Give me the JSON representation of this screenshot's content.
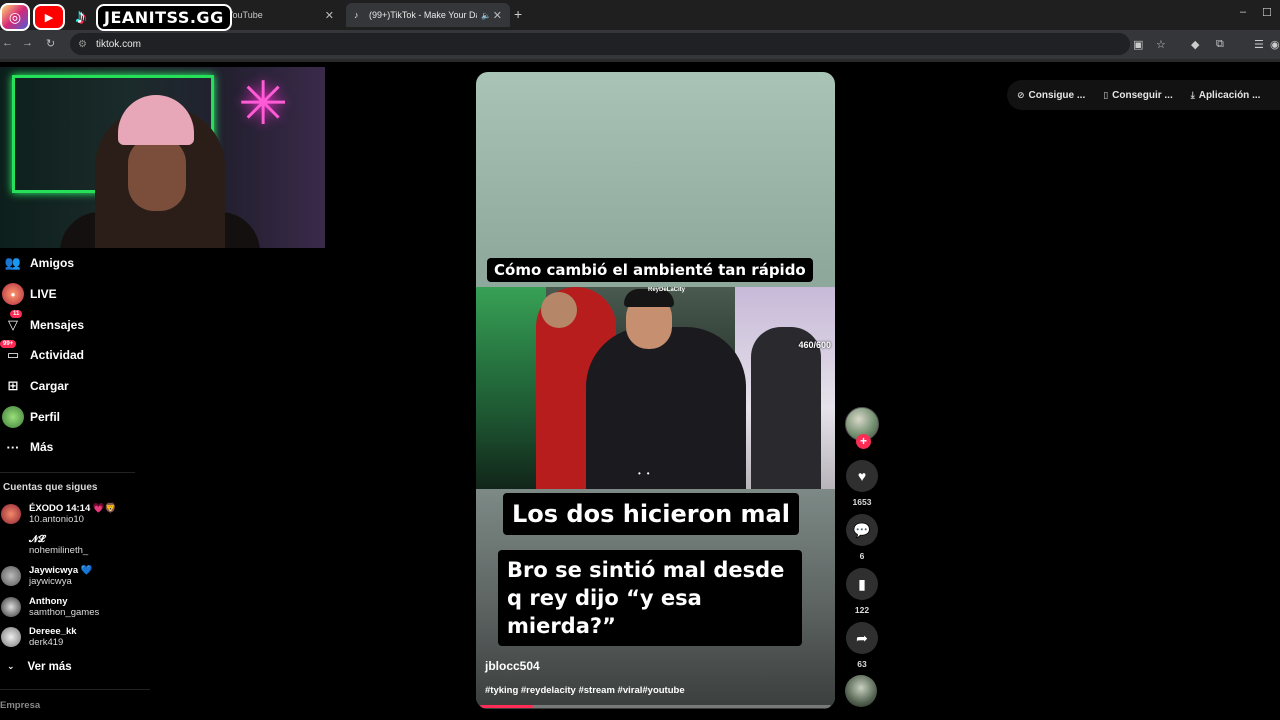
{
  "browser": {
    "tabs": [
      {
        "title": "(532) YouTube",
        "active": false
      },
      {
        "title": "(99+)TikTok - Make Your Da",
        "active": true
      }
    ],
    "url": "tiktok.com",
    "new_tab": "+",
    "window_min": "–",
    "window_max": "☐"
  },
  "overlay": {
    "streamer_name": "JEANITSS.GG"
  },
  "header": {
    "buttons": [
      {
        "label": "Consigue ...",
        "icon": "coin-icon"
      },
      {
        "label": "Conseguir ...",
        "icon": "phone-icon"
      },
      {
        "label": "Aplicación ...",
        "icon": "download-icon"
      }
    ]
  },
  "sidebar": {
    "items": [
      {
        "label": "Amigos",
        "icon": "friends-icon"
      },
      {
        "label": "LIVE",
        "icon": "live-icon"
      },
      {
        "label": "Mensajes",
        "icon": "messages-icon",
        "badge": "11"
      },
      {
        "label": "Actividad",
        "icon": "activity-icon",
        "badge": "99+"
      },
      {
        "label": "Cargar",
        "icon": "upload-icon"
      },
      {
        "label": "Perfil",
        "icon": "profile-icon"
      },
      {
        "label": "Más",
        "icon": "more-icon"
      }
    ],
    "following_title": "Cuentas que sigues",
    "following": [
      {
        "name": "ÉXODO 14:14 💗🦁",
        "user": "10.antonio10",
        "color": "#c0392b"
      },
      {
        "name": "𝓝𝓛",
        "user": "nohemilineth_",
        "color": "#000000"
      },
      {
        "name": "Jaywicwya 💙",
        "user": "jaywicwya",
        "color": "#777777"
      },
      {
        "name": "Anthony",
        "user": "samthon_games",
        "color": "#555555"
      },
      {
        "name": "Dereee_kk",
        "user": "derk419",
        "color": "#999999"
      }
    ],
    "see_more": "Ver más",
    "footer": "Empresa"
  },
  "video": {
    "caption_top": "Cómo cambió el ambienté tan rápido",
    "stream_tag": "ReyDeLaCity",
    "counter": "460/600",
    "caption_main": "Los dos hicieron mal",
    "caption_sub": "Bro se sintió mal desde q rey dijo “y esa mierda?”",
    "author": "jblocc504",
    "hashtags": "#tyking #reydelacity #stream #viral#youtube",
    "progress": 0.15,
    "accent": "#fe2c55"
  },
  "actions": {
    "likes": "1653",
    "comments": "6",
    "saves": "122",
    "shares": "63"
  }
}
